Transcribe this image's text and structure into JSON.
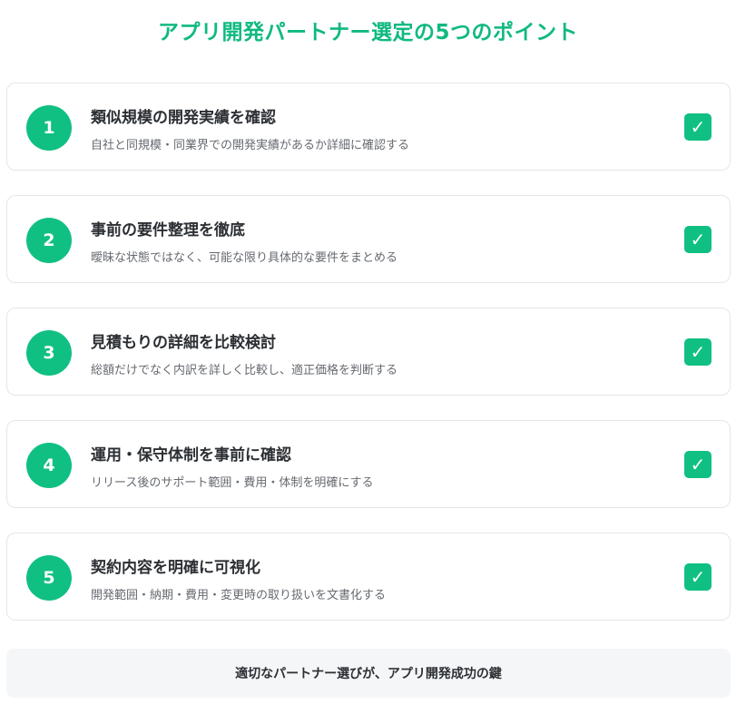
{
  "title": "アプリ開発パートナー選定の5つのポイント",
  "icons": {
    "check": "checkmark-icon",
    "check_glyph": "✓"
  },
  "colors": {
    "accent": "#10c082",
    "title": "#10b981"
  },
  "points": [
    {
      "number": "1",
      "title": "類似規模の開発実績を確認",
      "description": "自社と同規模・同業界での開発実績があるか詳細に確認する"
    },
    {
      "number": "2",
      "title": "事前の要件整理を徹底",
      "description": "曖昧な状態ではなく、可能な限り具体的な要件をまとめる"
    },
    {
      "number": "3",
      "title": "見積もりの詳細を比較検討",
      "description": "総額だけでなく内訳を詳しく比較し、適正価格を判断する"
    },
    {
      "number": "4",
      "title": "運用・保守体制を事前に確認",
      "description": "リリース後のサポート範囲・費用・体制を明確にする"
    },
    {
      "number": "5",
      "title": "契約内容を明確に可視化",
      "description": "開発範囲・納期・費用・変更時の取り扱いを文書化する"
    }
  ],
  "footer": {
    "text": "適切なパートナー選びが、アプリ開発成功の鍵"
  }
}
